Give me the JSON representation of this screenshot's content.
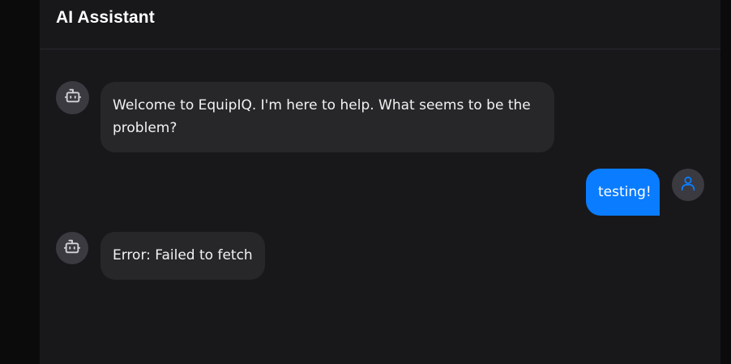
{
  "header": {
    "title": "AI Assistant"
  },
  "messages": [
    {
      "role": "assistant",
      "text": "Welcome to EquipIQ. I'm here to help. What seems to be the problem?",
      "avatar_icon": "robot-icon"
    },
    {
      "role": "user",
      "text": "testing!",
      "avatar_icon": "user-icon"
    },
    {
      "role": "assistant",
      "text": "Error: Failed to fetch",
      "avatar_icon": "robot-icon"
    }
  ],
  "colors": {
    "background": "#18181b",
    "assistant_bubble": "#27272a",
    "user_bubble": "#0a7cff",
    "avatar_bg": "#3a3a40",
    "user_icon": "#0a7cff"
  }
}
